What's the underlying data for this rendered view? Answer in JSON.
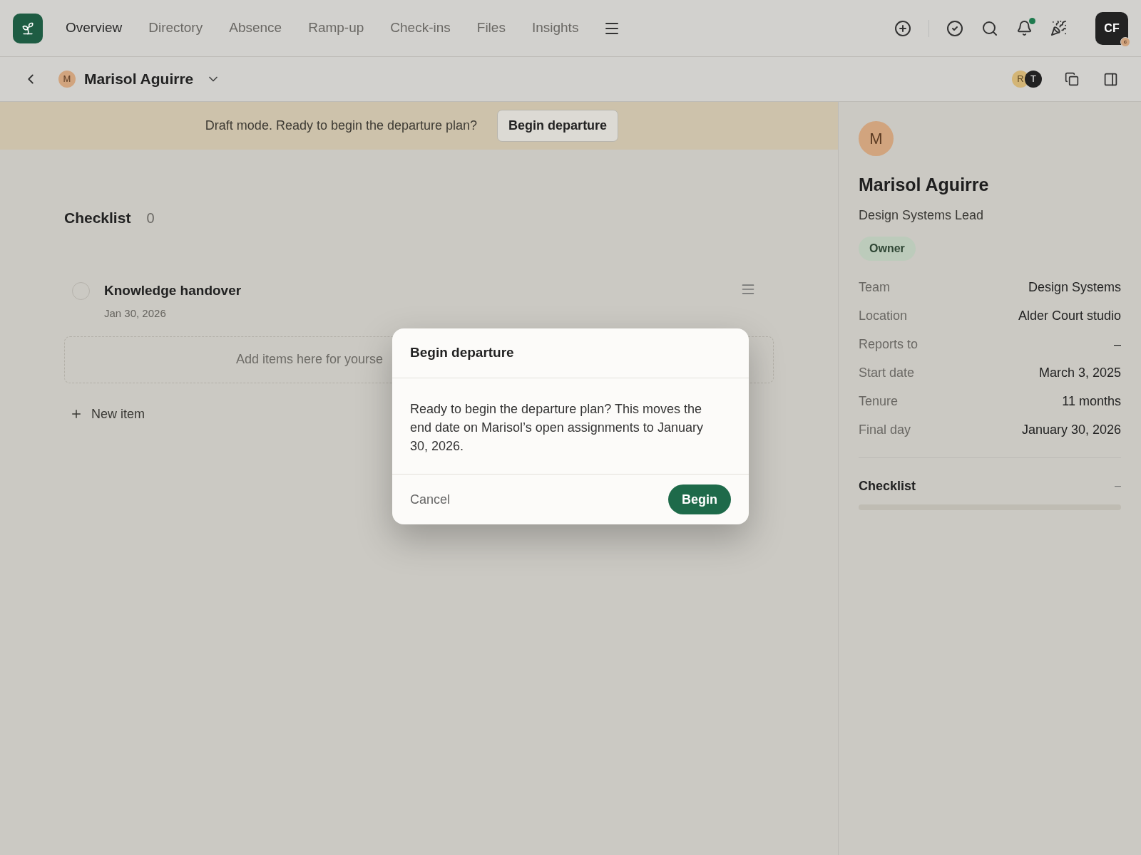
{
  "nav": {
    "items": [
      {
        "label": "Overview",
        "selected": true
      },
      {
        "label": "Directory",
        "selected": false
      },
      {
        "label": "Absence",
        "selected": false
      },
      {
        "label": "Ramp-up",
        "selected": false
      },
      {
        "label": "Check-ins",
        "selected": false
      },
      {
        "label": "Files",
        "selected": false
      },
      {
        "label": "Insights",
        "selected": false
      }
    ],
    "notifications_unread": true,
    "user_initials": "CF",
    "user_badge": "c"
  },
  "header": {
    "avatar_initial": "M",
    "name": "Marisol Aguirre",
    "viewers": [
      "R",
      "T"
    ]
  },
  "banner": {
    "text": "Draft mode. Ready to begin the departure plan?",
    "button": "Begin departure"
  },
  "checklist": {
    "title": "Checklist",
    "count": "0",
    "items": [
      {
        "title": "Knowledge handover",
        "date": "Jan 30, 2026",
        "checked": false
      }
    ],
    "dropzone": "Add items here for yourse",
    "new_item": "New item"
  },
  "profile": {
    "avatar_initial": "M",
    "name": "Marisol Aguirre",
    "role": "Design Systems Lead",
    "badge": "Owner",
    "fields": [
      {
        "label": "Team",
        "value": "Design Systems"
      },
      {
        "label": "Location",
        "value": "Alder Court studio"
      },
      {
        "label": "Reports to",
        "value": "–"
      },
      {
        "label": "Start date",
        "value": "March 3, 2025"
      },
      {
        "label": "Tenure",
        "value": "11 months"
      },
      {
        "label": "Final day",
        "value": "January 30, 2026"
      }
    ],
    "checklist": {
      "title": "Checklist",
      "value": "–",
      "level": 0
    }
  },
  "dialog": {
    "title": "Begin departure",
    "body": "Ready to begin the departure plan? This moves the end date on Marisol’s open assignments to January 30, 2026.",
    "cancel": "Cancel",
    "confirm": "Begin"
  }
}
